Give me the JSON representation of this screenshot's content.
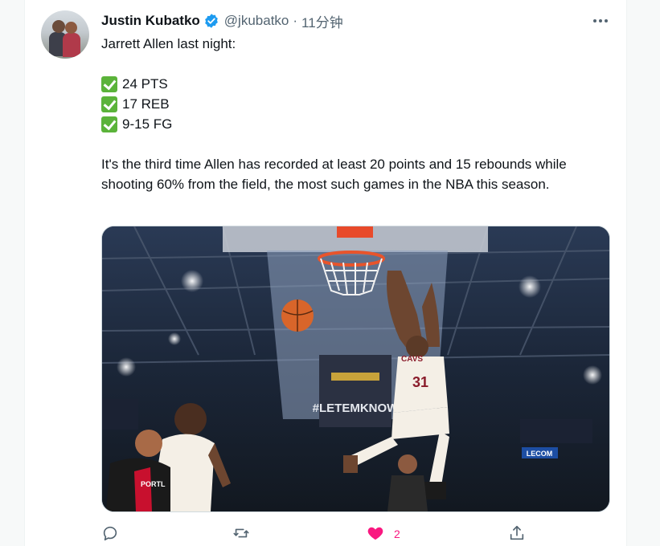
{
  "tweet": {
    "author_name": "Justin Kubatko",
    "handle": "@jkubatko",
    "separator": "·",
    "time": "11分钟",
    "intro": "Jarrett Allen last night:",
    "stats": [
      "24 PTS",
      "17 REB",
      "9-15 FG"
    ],
    "body": "It's the third time Allen has recorded at least 20 points and 15 rebounds while shooting 60% from the field, the most such games in the NBA this season.",
    "media_text": {
      "jersey_number": "31",
      "jersey_team": "CAVS",
      "banner": "#LETEMKNOW",
      "arena_sign": "LECOM",
      "opponent": "PORTL"
    },
    "icons": {
      "verified": "verified-badge-icon",
      "more": "more-icon",
      "reply": "reply-icon",
      "retweet": "retweet-icon",
      "like": "heart-icon",
      "share": "share-icon",
      "check": "check-mark-icon"
    },
    "like_count": "2"
  },
  "colors": {
    "verified": "#1d9bf0",
    "like": "#f91880",
    "check": "#5bb33a",
    "muted": "#536471"
  }
}
